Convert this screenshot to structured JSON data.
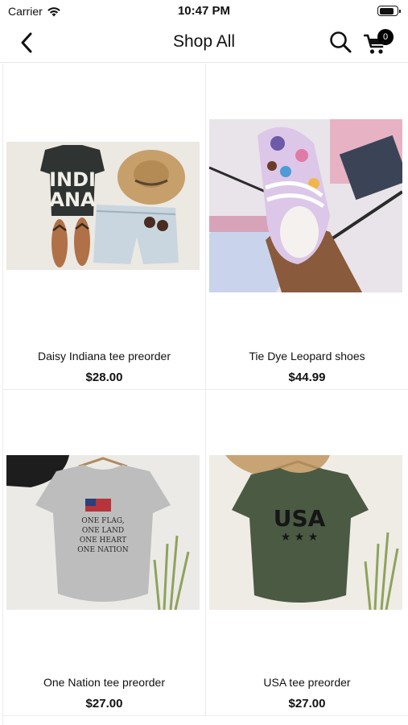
{
  "status_bar": {
    "carrier": "Carrier",
    "time": "10:47 PM",
    "battery_level": 0.85
  },
  "nav": {
    "title": "Shop All",
    "back_icon": "chevron-left-icon",
    "search_icon": "search-icon",
    "cart_icon": "cart-icon",
    "cart_count": "0"
  },
  "products": [
    {
      "name": "Daisy Indiana tee preorder",
      "price": "$28.00",
      "image": "outfit-flatlay-image",
      "print": "INDI ANA"
    },
    {
      "name": "Tie Dye Leopard shoes",
      "price": "$44.99",
      "image": "leopard-shoe-image"
    },
    {
      "name": "One Nation tee preorder",
      "price": "$27.00",
      "image": "gray-tee-image",
      "print_lines": [
        "ONE FLAG,",
        "ONE LAND",
        "ONE HEART",
        "ONE NATION"
      ]
    },
    {
      "name": "USA tee preorder",
      "price": "$27.00",
      "image": "green-tee-image",
      "print": "USA"
    }
  ],
  "colors": {
    "text": "#111111",
    "badge": "#000000",
    "divider": "#ececec"
  }
}
